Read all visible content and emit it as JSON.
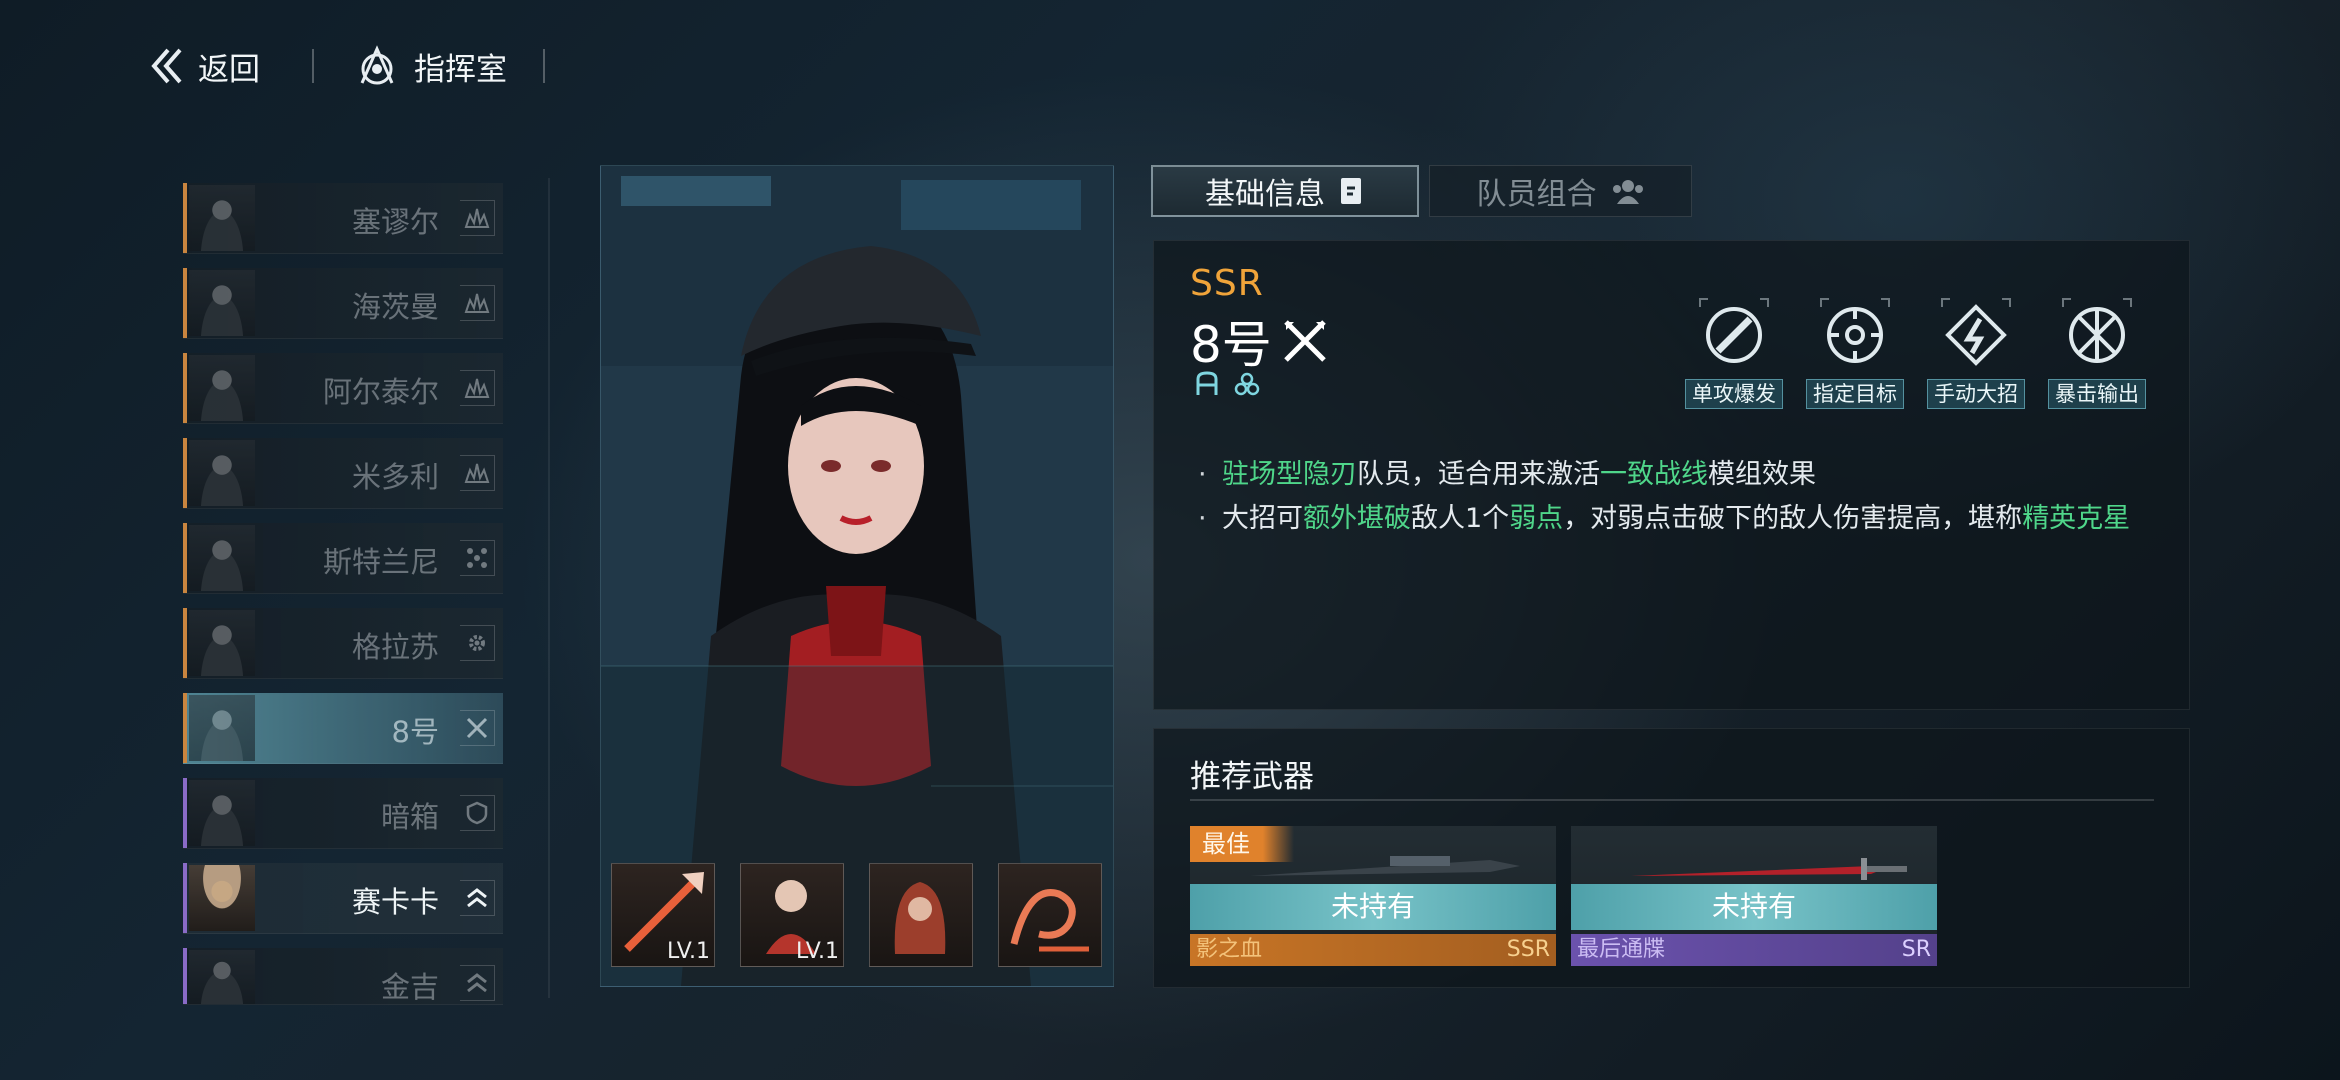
{
  "topbar": {
    "back_label": "返回",
    "command_label": "指挥室"
  },
  "roster": [
    {
      "name": "塞谬尔",
      "class_icon": "flame-class-icon"
    },
    {
      "name": "海茨曼",
      "class_icon": "flame-class-icon"
    },
    {
      "name": "阿尔泰尔",
      "class_icon": "flame-class-icon"
    },
    {
      "name": "米多利",
      "class_icon": "flame-class-icon"
    },
    {
      "name": "斯特兰尼",
      "class_icon": "cluster-class-icon"
    },
    {
      "name": "格拉苏",
      "class_icon": "gear-class-icon"
    },
    {
      "name": "8号",
      "class_icon": "crossed-blades-class-icon",
      "selected": true
    },
    {
      "name": "暗箱",
      "class_icon": "shield-class-icon"
    },
    {
      "name": "赛卡卡",
      "class_icon": "chevron-class-icon"
    },
    {
      "name": "金吉",
      "class_icon": "chevron-class-icon"
    }
  ],
  "skills": [
    {
      "level": "LV.1",
      "icon": "spear-skill-icon"
    },
    {
      "level": "LV.1",
      "icon": "figure-skill-icon"
    },
    {
      "level": "",
      "icon": "hooded-skill-icon"
    },
    {
      "level": "",
      "icon": "wave-skill-icon"
    }
  ],
  "tabs": {
    "basic_info": "基础信息",
    "team_combo": "队员组合"
  },
  "character": {
    "rarity": "SSR",
    "name": "8号",
    "traits": [
      "单攻爆发",
      "指定目标",
      "手动大招",
      "暴击输出"
    ],
    "desc1": {
      "a": "驻场型隐刃",
      "b": "队员，适合用来激活",
      "c": "一致战线",
      "d": "模组效果"
    },
    "desc2": {
      "a": "大招可",
      "b": "额外堪破",
      "c": "敌人1个",
      "d": "弱点",
      "e": "，对弱点击破下的敌人伤害提高，堪称",
      "f": "精英克星"
    }
  },
  "weapons": {
    "title": "推荐武器",
    "items": [
      {
        "badge": "最佳",
        "status": "未持有",
        "name": "影之血",
        "rarity": "SSR"
      },
      {
        "badge": "",
        "status": "未持有",
        "name": "最后通牒",
        "rarity": "SR"
      }
    ]
  },
  "colors": {
    "rarity_ssr": "#f0a43a",
    "highlight_green": "#4fd68a",
    "teal_accent": "#78c3c8",
    "sr_purple": "#6b52ad"
  }
}
